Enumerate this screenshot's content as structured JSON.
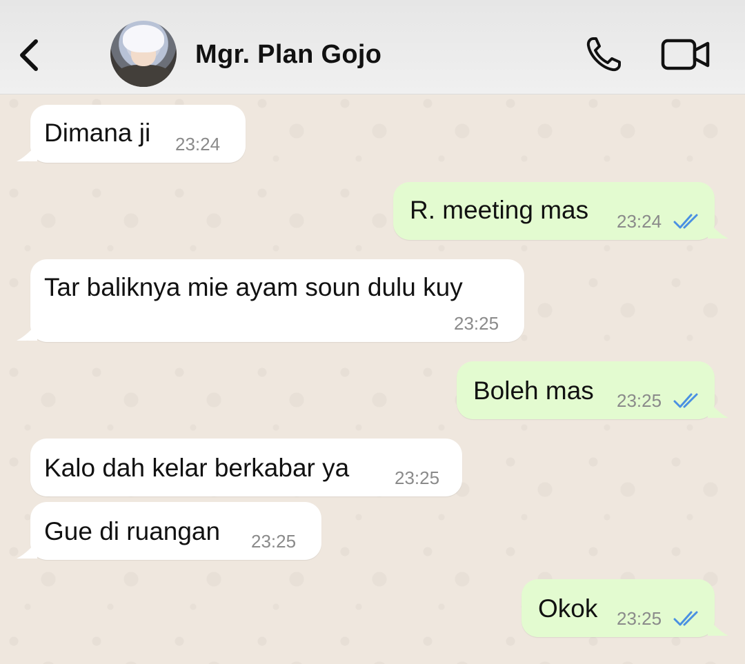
{
  "header": {
    "contact_name": "Mgr. Plan Gojo",
    "icons": {
      "back": "chevron-left-icon",
      "call": "phone-icon",
      "video": "video-camera-icon"
    }
  },
  "colors": {
    "incoming_bubble": "#ffffff",
    "outgoing_bubble": "#e3fbd0",
    "read_ticks": "#4a90e2",
    "wallpaper": "#efe7de"
  },
  "messages": [
    {
      "direction": "incoming",
      "text": "Dimana ji",
      "time": "23:24"
    },
    {
      "direction": "outgoing",
      "text": "R. meeting mas",
      "time": "23:24",
      "status": "read"
    },
    {
      "direction": "incoming",
      "text": "Tar baliknya mie ayam soun dulu kuy",
      "time": "23:25"
    },
    {
      "direction": "outgoing",
      "text": "Boleh mas",
      "time": "23:25",
      "status": "read"
    },
    {
      "direction": "incoming",
      "text": "Kalo dah kelar berkabar ya",
      "time": "23:25"
    },
    {
      "direction": "incoming",
      "text": "Gue di ruangan",
      "time": "23:25"
    },
    {
      "direction": "outgoing",
      "text": "Okok",
      "time": "23:25",
      "status": "read"
    }
  ]
}
